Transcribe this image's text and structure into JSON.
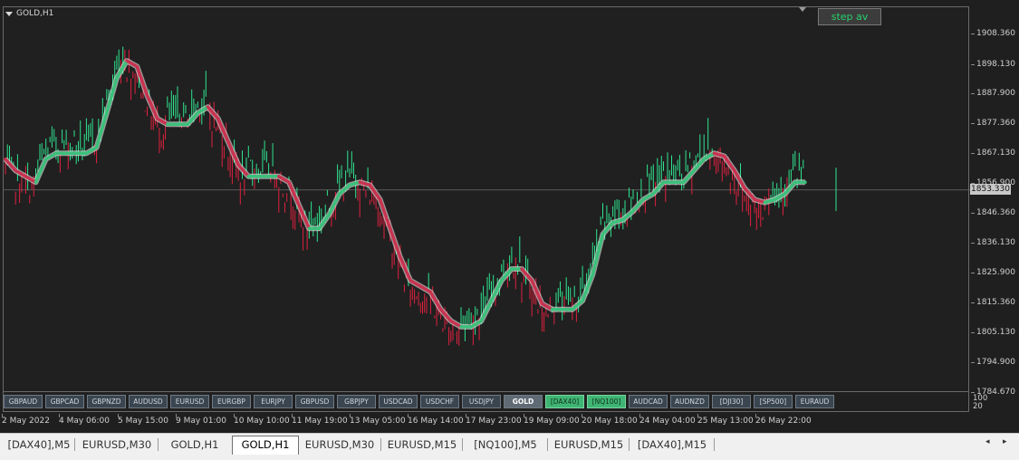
{
  "chart": {
    "title": "GOLD,H1",
    "step_button": "step av",
    "current_price": "1853.330",
    "price_labels": [
      "1908.360",
      "1898.130",
      "1887.900",
      "1877.360",
      "1867.130",
      "1856.900",
      "1846.360",
      "1836.130",
      "1825.900",
      "1815.360",
      "1805.130",
      "1794.900",
      "1784.670"
    ],
    "indicator_labels": [
      "100",
      "20"
    ],
    "time_labels": [
      "2 May 2022",
      "4 May 06:00",
      "5 May 15:00",
      "9 May 01:00",
      "10 May 10:00",
      "11 May 19:00",
      "13 May 05:00",
      "16 May 14:00",
      "17 May 23:00",
      "19 May 09:00",
      "20 May 18:00",
      "24 May 04:00",
      "25 May 13:00",
      "26 May 22:00"
    ]
  },
  "symbol_buttons": [
    {
      "label": "GBPAUD",
      "state": "normal"
    },
    {
      "label": "GBPCAD",
      "state": "normal"
    },
    {
      "label": "GBPNZD",
      "state": "normal"
    },
    {
      "label": "AUDUSD",
      "state": "normal"
    },
    {
      "label": "EURUSD",
      "state": "normal"
    },
    {
      "label": "EURGBP",
      "state": "normal"
    },
    {
      "label": "EURJPY",
      "state": "normal"
    },
    {
      "label": "GBPUSD",
      "state": "normal"
    },
    {
      "label": "GBPJPY",
      "state": "normal"
    },
    {
      "label": "USDCAD",
      "state": "normal"
    },
    {
      "label": "USDCHF",
      "state": "normal"
    },
    {
      "label": "USDJPY",
      "state": "normal"
    },
    {
      "label": "GOLD",
      "state": "active"
    },
    {
      "label": "[DAX40]",
      "state": "highlight"
    },
    {
      "label": "[NQ100]",
      "state": "highlight"
    },
    {
      "label": "AUDCAD",
      "state": "normal"
    },
    {
      "label": "AUDNZD",
      "state": "normal"
    },
    {
      "label": "[DJI30]",
      "state": "normal"
    },
    {
      "label": "[SP500]",
      "state": "normal"
    },
    {
      "label": "EURAUD",
      "state": "normal"
    }
  ],
  "tabs": [
    {
      "label": "[DAX40],M5",
      "active": false
    },
    {
      "label": "EURUSD,M30",
      "active": false
    },
    {
      "label": "GOLD,H1",
      "active": false
    },
    {
      "label": "GOLD,H1",
      "active": true
    },
    {
      "label": "EURUSD,M30",
      "active": false
    },
    {
      "label": "EURUSD,M15",
      "active": false
    },
    {
      "label": "[NQ100],M5",
      "active": false
    },
    {
      "label": "EURUSD,M15",
      "active": false
    },
    {
      "label": "[DAX40],M15",
      "active": false
    }
  ],
  "nav": {
    "left": "◂",
    "right": "▸"
  },
  "colors": {
    "up": "#2fe38f",
    "down": "#e0213f",
    "step_up": "#3cc07a",
    "step_down": "#c8334f",
    "step_highlight": "#ffffff"
  },
  "chart_data": {
    "type": "line",
    "series": [
      {
        "values": [
          1864,
          1860,
          1858,
          1856,
          1864,
          1866,
          1866,
          1866,
          1866,
          1868,
          1880,
          1892,
          1898,
          1896,
          1886,
          1878,
          1876,
          1876,
          1876,
          1880,
          1882,
          1878,
          1870,
          1862,
          1858,
          1858,
          1858,
          1858,
          1856,
          1848,
          1840,
          1840,
          1845,
          1852,
          1855,
          1856,
          1855,
          1850,
          1840,
          1830,
          1822,
          1820,
          1818,
          1812,
          1808,
          1806,
          1806,
          1808,
          1815,
          1822,
          1826,
          1826,
          1822,
          1814,
          1812,
          1812,
          1812,
          1815,
          1824,
          1838,
          1842,
          1843,
          1846,
          1850,
          1852,
          1856,
          1856,
          1856,
          1860,
          1864,
          1866,
          1865,
          1860,
          1854,
          1850,
          1849,
          1850,
          1852,
          1856,
          1856
        ]
      }
    ]
  }
}
